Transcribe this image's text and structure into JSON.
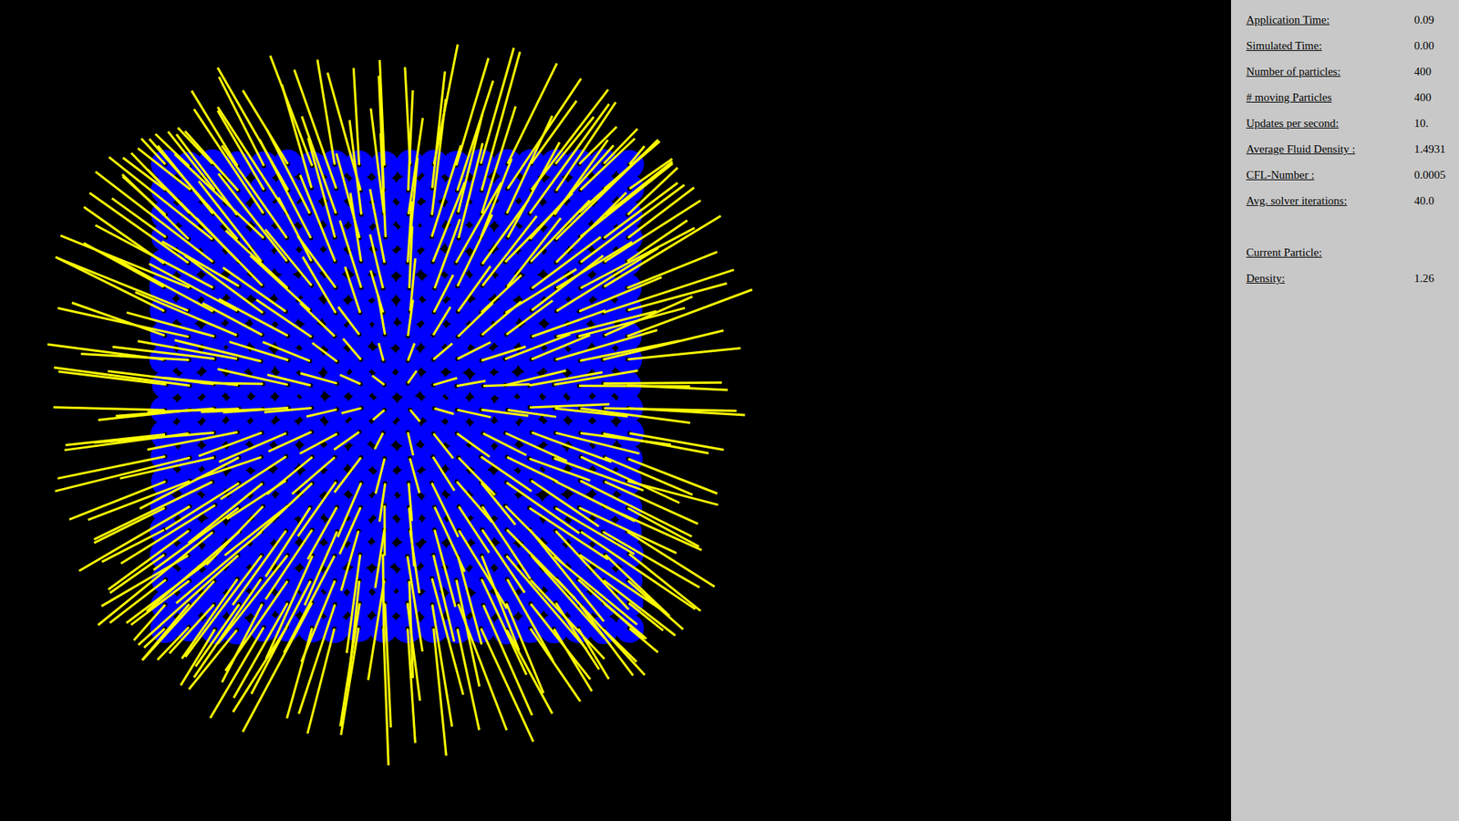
{
  "stats": [
    {
      "label": "Application Time:",
      "value": "0.09"
    },
    {
      "label": "Simulated Time:",
      "value": "0.00"
    },
    {
      "label": "Number of particles:",
      "value": "400"
    },
    {
      "label": "# moving Particles",
      "value": "400"
    },
    {
      "label": "Updates per second:",
      "value": "10."
    },
    {
      "label": "Average Fluid Density :",
      "value": "1.4931"
    },
    {
      "label": "CFL-Number :",
      "value": "0.0005"
    },
    {
      "label": "Avg. solver iterations:",
      "value": "40.0"
    }
  ],
  "current_particle": {
    "label": "Current Particle:",
    "fields": [
      {
        "label": "Density:",
        "value": "1.26"
      }
    ]
  }
}
